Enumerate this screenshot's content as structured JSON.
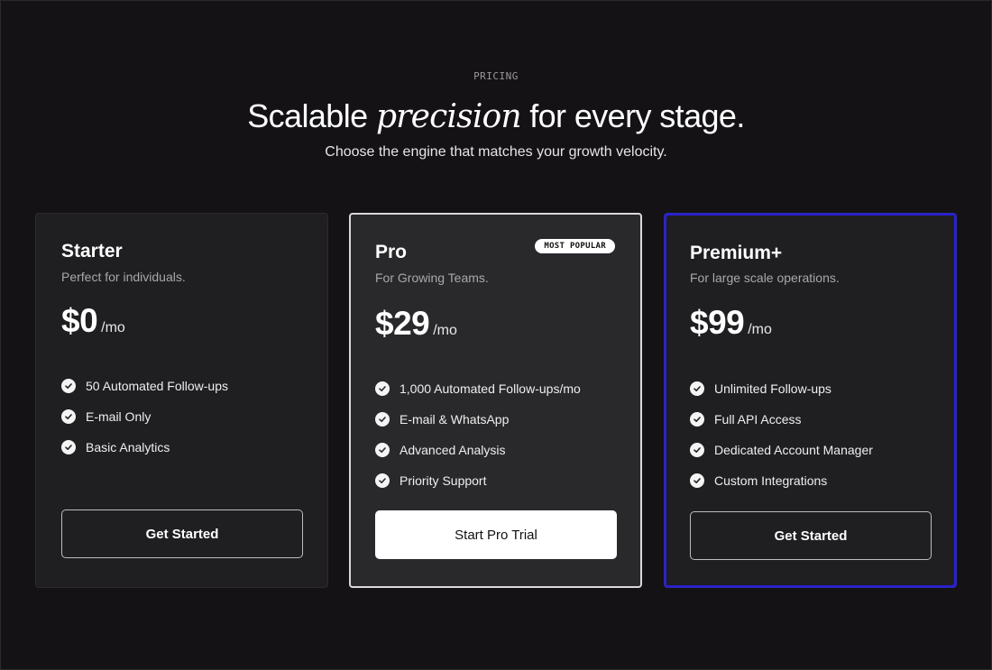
{
  "header": {
    "eyebrow": "PRICING",
    "headline_pre": "Scalable ",
    "headline_accent": "precision",
    "headline_post": " for every stage.",
    "subheadline": "Choose the engine that matches your growth velocity."
  },
  "plans": [
    {
      "name": "Starter",
      "description": "Perfect for individuals.",
      "price": "$0",
      "unit": "/mo",
      "features": [
        "50 Automated Follow-ups",
        "E-mail Only",
        "Basic Analytics"
      ],
      "button_label": "Get Started"
    },
    {
      "name": "Pro",
      "badge": "MOST POPULAR",
      "description": "For Growing Teams.",
      "price": "$29",
      "unit": "/mo",
      "features": [
        "1,000 Automated Follow-ups/mo",
        "E-mail & WhatsApp",
        "Advanced Analysis",
        "Priority Support"
      ],
      "button_label": "Start Pro Trial"
    },
    {
      "name": "Premium+",
      "description": "For large scale operations.",
      "price": "$99",
      "unit": "/mo",
      "features": [
        "Unlimited Follow-ups",
        "Full API Access",
        "Dedicated Account Manager",
        "Custom Integrations"
      ],
      "button_label": "Get Started"
    }
  ],
  "icons": {
    "feature": "check-circle-icon"
  },
  "colors": {
    "background": "#141215",
    "card": "#1f1e21",
    "pro_card": "#29282b",
    "pro_border": "#d9d9d9",
    "premium_glow": "#2a1fd6",
    "text_primary": "#ffffff",
    "text_muted": "#a8a8ac"
  }
}
